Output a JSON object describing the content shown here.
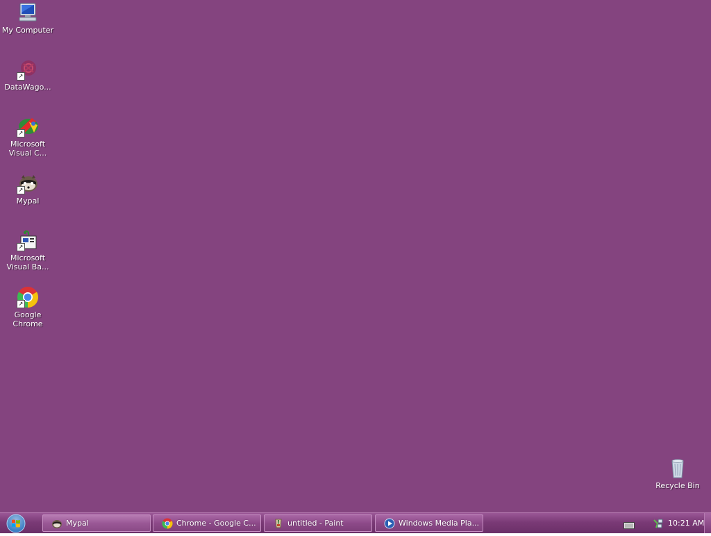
{
  "desktop": {
    "background_color": "#84447f",
    "icons": [
      {
        "label": "My Computer",
        "icon": "computer-icon"
      },
      {
        "label": "DataWago...",
        "icon": "datawagon-icon",
        "shortcut": true
      },
      {
        "label": "Microsoft\nVisual C...",
        "icon": "visual-c-icon",
        "shortcut": true
      },
      {
        "label": "Mypal",
        "icon": "mypal-icon",
        "shortcut": true
      },
      {
        "label": "Microsoft\nVisual Ba...",
        "icon": "visual-basic-icon",
        "shortcut": true
      },
      {
        "label": "Google\nChrome",
        "icon": "chrome-icon",
        "shortcut": true
      },
      {
        "label": "Recycle Bin",
        "icon": "recycle-bin-icon"
      }
    ]
  },
  "taskbar": {
    "start_icon": "windows-start-icon",
    "buttons": [
      {
        "label": "Mypal",
        "icon": "mypal-icon"
      },
      {
        "label": "Chrome - Google C...",
        "icon": "chrome-icon"
      },
      {
        "label": "untitled - Paint",
        "icon": "paint-icon"
      },
      {
        "label": "Windows Media Pla...",
        "icon": "media-player-icon"
      }
    ],
    "tray": {
      "keyboard_icon": "keyboard-icon",
      "network_icon": "network-icon",
      "clock": "10:21 AM"
    }
  }
}
